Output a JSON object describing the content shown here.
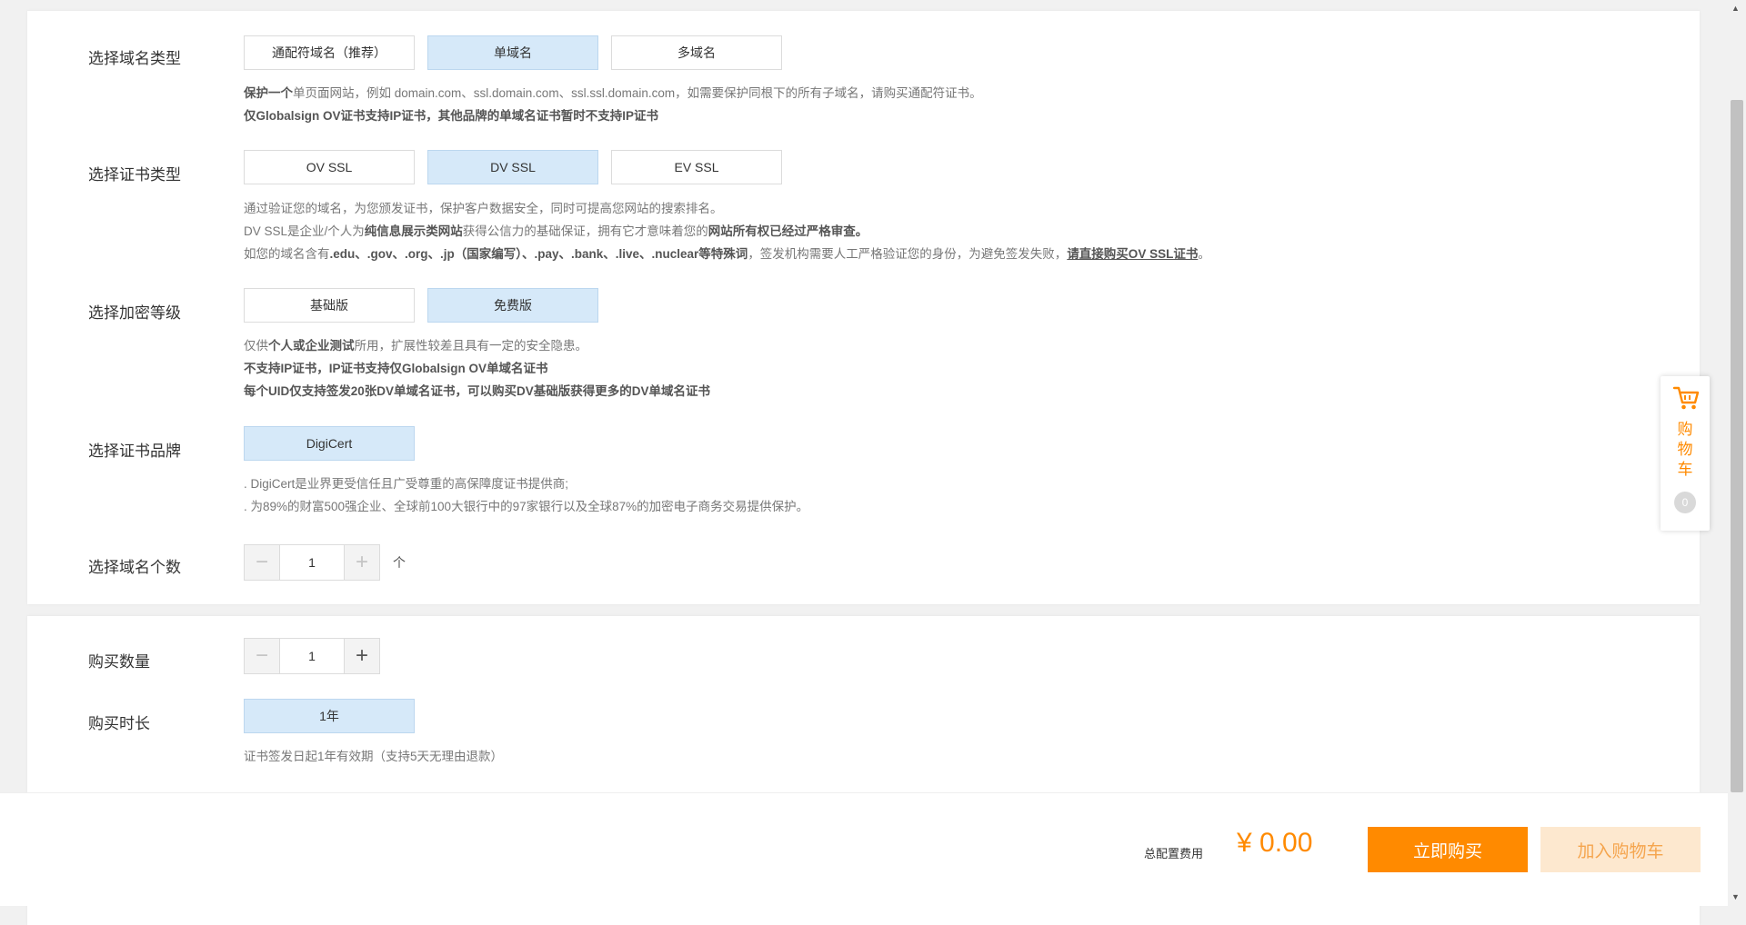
{
  "colors": {
    "accent": "#ff8a00",
    "selected_bg": "#d6e9f9",
    "cart_bg": "#fde8cf"
  },
  "domain_type": {
    "label": "选择域名类型",
    "options": [
      "通配符域名（推荐）",
      "单域名",
      "多域名"
    ],
    "selected": "单域名",
    "desc": {
      "line1_a": "保护一个",
      "line1_b": "单页面网站，例如 domain.com、ssl.domain.com、ssl.ssl.domain.com，如需要保护同根下的所有子域名，请购买通配符证书。",
      "line2": "仅Globalsign OV证书支持IP证书，其他品牌的单域名证书暂时不支持IP证书"
    }
  },
  "cert_type": {
    "label": "选择证书类型",
    "options": [
      "OV SSL",
      "DV SSL",
      "EV SSL"
    ],
    "selected": "DV SSL",
    "desc": {
      "line1": "通过验证您的域名，为您颁发证书，保护客户数据安全，同时可提高您网站的搜索排名。",
      "line2_a": "DV SSL是企业/个人为",
      "line2_b": "纯信息展示类网站",
      "line2_c": "获得公信力的基础保证，拥有它才意味着您的",
      "line2_d": "网站所有权已经过严格审查。",
      "line3_a": "如您的域名含有",
      "line3_b": ".edu、.gov、.org、.jp（国家编写）、.pay、.bank、.live、.nuclear等特殊词",
      "line3_c": "，签发机构需要人工严格验证您的身份，为避免签发失败，",
      "line3_link": "请直接购买OV SSL证书",
      "line3_d": "。"
    }
  },
  "encryption": {
    "label": "选择加密等级",
    "options": [
      "基础版",
      "免费版"
    ],
    "selected": "免费版",
    "desc": {
      "line1_a": "仅供",
      "line1_b": "个人或企业测试",
      "line1_c": "所用，扩展性较差且具有一定的安全隐患。",
      "line2": "不支持IP证书，IP证书支持仅Globalsign OV单域名证书",
      "line3": "每个UID仅支持签发20张DV单域名证书，可以购买DV基础版获得更多的DV单域名证书"
    }
  },
  "brand": {
    "label": "选择证书品牌",
    "options": [
      "DigiCert"
    ],
    "selected": "DigiCert",
    "desc": {
      "line1": ". DigiCert是业界更受信任且广受尊重的高保障度证书提供商;",
      "line2": ". 为89%的财富500强企业、全球前100大银行中的97家银行以及全球87%的加密电子商务交易提供保护。"
    }
  },
  "domain_count": {
    "label": "选择域名个数",
    "value": "1",
    "unit": "个",
    "minus": "−",
    "plus": "+"
  },
  "purchase_qty": {
    "label": "购买数量",
    "value": "1",
    "minus": "−",
    "plus": "+"
  },
  "duration": {
    "label": "购买时长",
    "options": [
      "1年"
    ],
    "selected": "1年",
    "desc": "证书签发日起1年有效期（支持5天无理由退款）"
  },
  "footer": {
    "total_label": "总配置费用",
    "total_price": "¥ 0.00",
    "buy_now": "立即购买",
    "add_to_cart": "加入购物车"
  },
  "float_cart": {
    "icon": "cart-icon",
    "text": "购物车",
    "count": "0"
  }
}
